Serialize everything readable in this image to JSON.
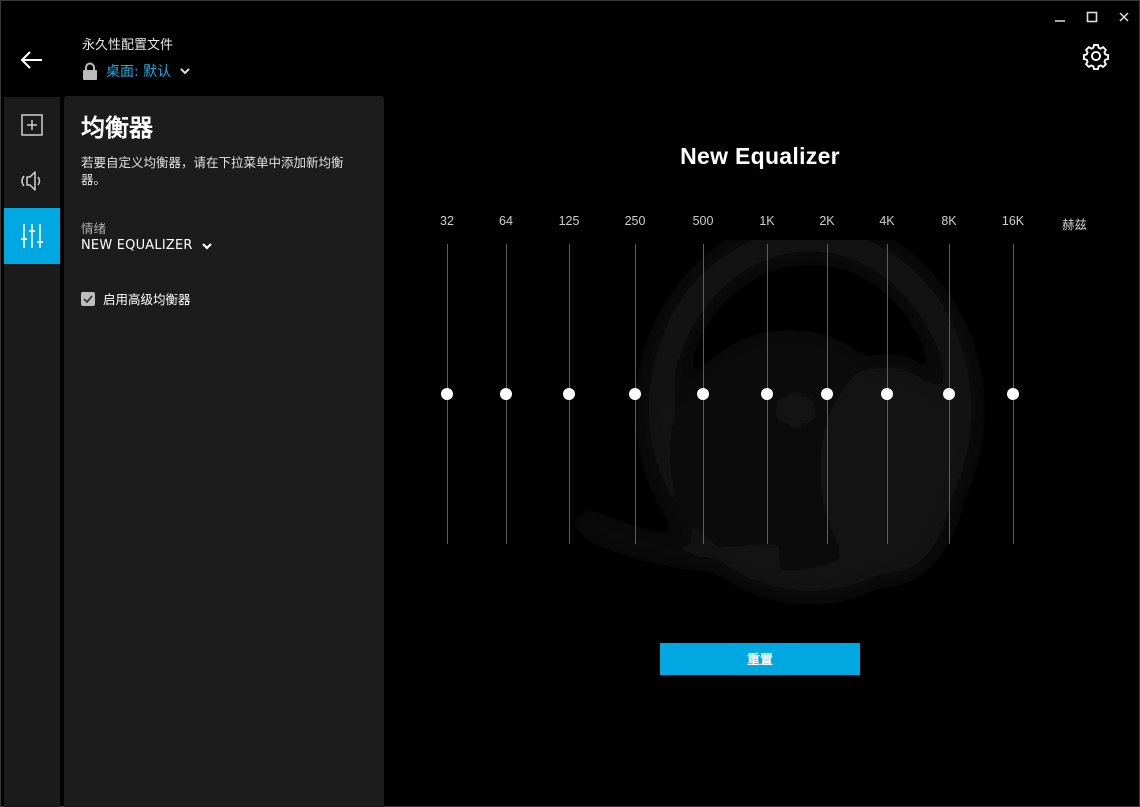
{
  "window": {
    "minimize": "–",
    "maximize": "☐",
    "close": "✕"
  },
  "header": {
    "profile_title": "永久性配置文件",
    "profile_name": "桌面: 默认"
  },
  "rail": {
    "items": [
      {
        "name": "add-icon",
        "active": false
      },
      {
        "name": "speaker-icon",
        "active": false
      },
      {
        "name": "equalizer-icon",
        "active": true
      }
    ]
  },
  "panel": {
    "title": "均衡器",
    "description": "若要自定义均衡器，请在下拉菜单中添加新均衡器。",
    "preset_label": "情绪",
    "preset_value": "NEW EQUALIZER",
    "advanced_label": "启用高级均衡器",
    "advanced_checked": true
  },
  "equalizer": {
    "title": "New Equalizer",
    "unit": "赫兹",
    "bands": [
      {
        "label": "32",
        "gain_db": 0
      },
      {
        "label": "64",
        "gain_db": 0
      },
      {
        "label": "125",
        "gain_db": 0
      },
      {
        "label": "250",
        "gain_db": 0
      },
      {
        "label": "500",
        "gain_db": 0
      },
      {
        "label": "1K",
        "gain_db": 0
      },
      {
        "label": "2K",
        "gain_db": 0
      },
      {
        "label": "4K",
        "gain_db": 0
      },
      {
        "label": "8K",
        "gain_db": 0
      },
      {
        "label": "16K",
        "gain_db": 0
      }
    ],
    "gain_range_db": [
      -12,
      12
    ],
    "reset_label": "重置"
  },
  "colors": {
    "accent": "#00a8e1",
    "panel": "#1c1c1c",
    "rail": "#1b1b1b",
    "background": "#000000"
  }
}
